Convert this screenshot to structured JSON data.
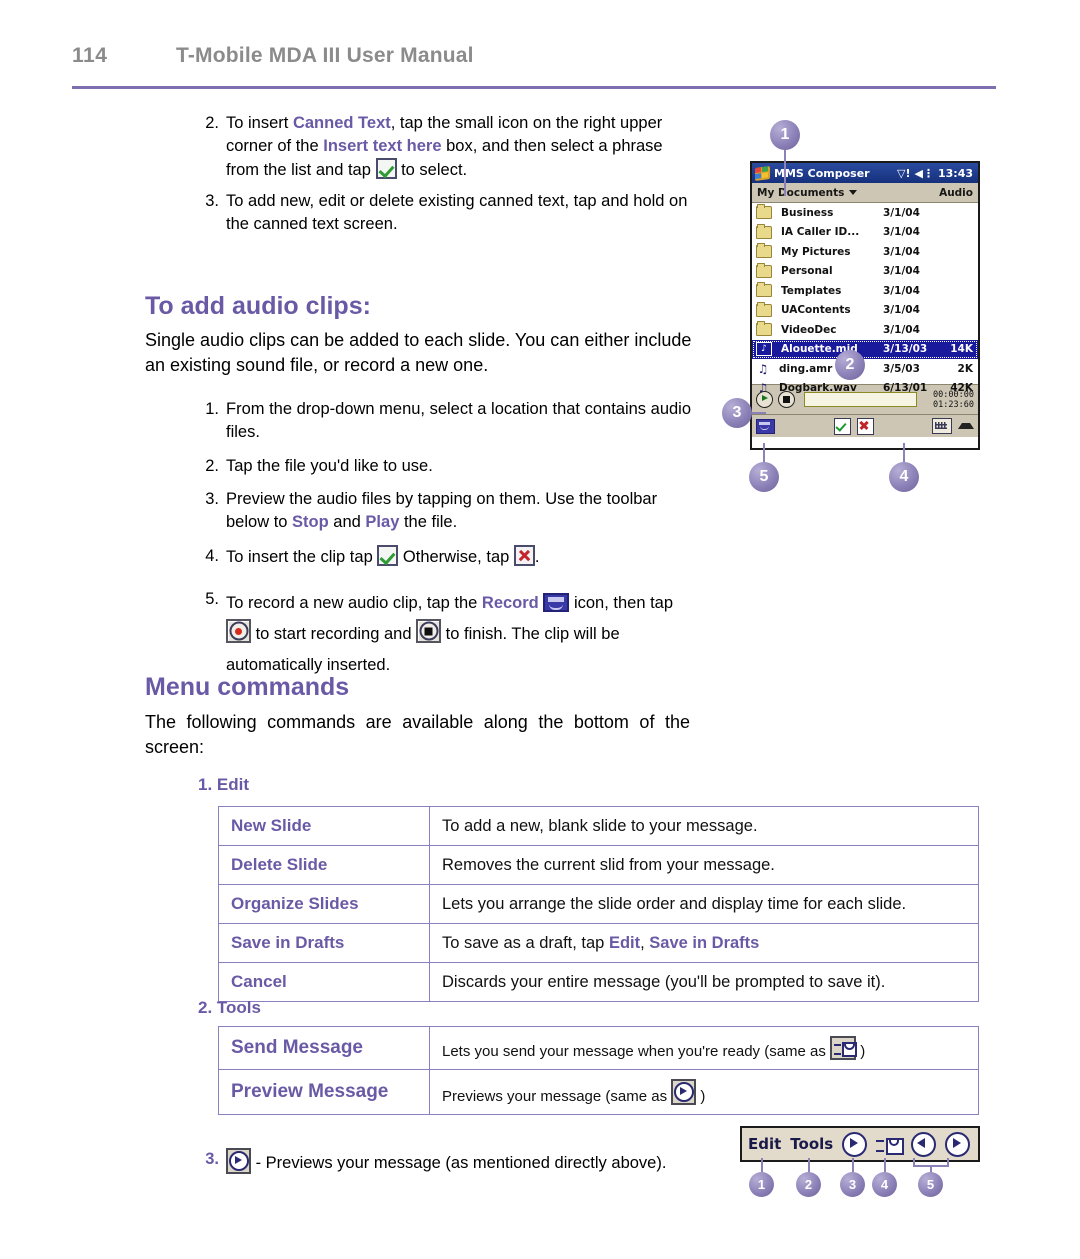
{
  "header": {
    "page_number": "114",
    "book_title": "T-Mobile MDA III User Manual"
  },
  "top_steps": [
    {
      "num": "2.",
      "parts": [
        {
          "t": "To insert ",
          "style": "plain"
        },
        {
          "t": "Canned Text",
          "style": "purple"
        },
        {
          "t": ", tap the small icon on the right upper corner of the ",
          "style": "plain"
        },
        {
          "t": "Insert text here",
          "style": "purple"
        },
        {
          "t": " box, and then select a phrase from the list and tap ",
          "style": "plain"
        },
        {
          "t": "[check-icon]",
          "style": "icon-check"
        },
        {
          "t": " to select.",
          "style": "plain"
        }
      ]
    },
    {
      "num": "3.",
      "parts": [
        {
          "t": "To add new, edit or delete existing canned text, tap and hold on the canned text screen.",
          "style": "plain"
        }
      ]
    }
  ],
  "audio_section": {
    "heading": "To add audio clips:",
    "intro": "Single audio clips can be added to each slide. You can either include an existing sound file, or record a new one.",
    "steps": [
      {
        "num": "1.",
        "text": "From the drop-down menu, select a location that contains audio files."
      },
      {
        "num": "2.",
        "text": "Tap the file you'd like to use."
      },
      {
        "num": "3a.",
        "text": "Preview the audio files by tapping on them. Use the toolbar below to "
      },
      {
        "num": "3b_stop",
        "text": "Stop"
      },
      {
        "num": "3c",
        "text": " and "
      },
      {
        "num": "3d_play",
        "text": "Play"
      },
      {
        "num": "3e",
        "text": " the file."
      },
      {
        "num": "4a",
        "text": "To insert the clip tap "
      },
      {
        "num": "4b",
        "text": " Otherwise, tap "
      },
      {
        "num": "4c",
        "text": "."
      },
      {
        "num": "5a",
        "text": "To record a new audio clip, tap the "
      },
      {
        "num": "5b_record",
        "text": "Record"
      },
      {
        "num": "5c",
        "text": " icon, then tap "
      },
      {
        "num": "5d",
        "text": " to start recording and "
      },
      {
        "num": "5e",
        "text": " to finish. The clip will be automatically inserted."
      }
    ],
    "step1_num": "1.",
    "step1_text": "From the drop-down menu, select a location that contains audio files.",
    "step2_num": "2.",
    "step2_text": "Tap the file you'd like to use.",
    "step3_num": "3.",
    "step3_pre": "Preview the audio files by tapping on them. Use the toolbar below to ",
    "step3_stop": "Stop",
    "step3_mid": " and ",
    "step3_play": "Play",
    "step3_post": " the file.",
    "step4_num": "4.",
    "step4_pre": "To insert the clip tap ",
    "step4_mid": " Otherwise, tap ",
    "step4_post": ".",
    "step5_num": "5.",
    "step5_pre": "To record a new audio clip, tap the ",
    "step5_record": "Record",
    "step5_a": " icon, then tap ",
    "step5_b": " to start recording and ",
    "step5_c": " to finish. The clip will be automatically inserted."
  },
  "menu_section": {
    "heading": "Menu commands",
    "intro": "The following commands are available along the bottom of the screen:",
    "edit_heading": "1. Edit",
    "tools_heading": "2. Tools",
    "edit_rows": [
      {
        "key": "New Slide",
        "value": "To add a new, blank slide to your message."
      },
      {
        "key": "Delete Slide",
        "value": "Removes the current slid from your message."
      },
      {
        "key": "Organize Slides",
        "value": "Lets you arrange the slide order and display time for each slide."
      },
      {
        "key": "Save in Drafts",
        "value": "To save as a draft, tap ",
        "value_link1": "Edit",
        "value_sep": ", ",
        "value_link2": "Save in Drafts"
      },
      {
        "key": "Cancel",
        "value": "Discards your entire message (you'll be prompted to save it)."
      }
    ],
    "tools_rows": [
      {
        "key": "Send Message",
        "value_pre": "Lets you send your message when you're ready (same as ",
        "value_post": " )"
      },
      {
        "key": "Preview Message",
        "value_pre": "Previews your message (same as ",
        "value_post": " )"
      }
    ],
    "final_num": "3.",
    "final_text": " - Previews your message (as mentioned directly above)."
  },
  "pda": {
    "title": "MMS Composer",
    "signal_icon": "signal-icon",
    "speaker_icon": "speaker-icon",
    "clock": "13:43",
    "location": "My Documents",
    "right_label": "Audio",
    "rows": [
      {
        "type": "folder",
        "name": "Business",
        "date": "3/1/04",
        "size": ""
      },
      {
        "type": "folder",
        "name": "IA Caller ID...",
        "date": "3/1/04",
        "size": ""
      },
      {
        "type": "folder",
        "name": "My Pictures",
        "date": "3/1/04",
        "size": ""
      },
      {
        "type": "folder",
        "name": "Personal",
        "date": "3/1/04",
        "size": ""
      },
      {
        "type": "folder",
        "name": "Templates",
        "date": "3/1/04",
        "size": ""
      },
      {
        "type": "folder",
        "name": "UAContents",
        "date": "3/1/04",
        "size": ""
      },
      {
        "type": "folder",
        "name": "VideoDec",
        "date": "3/1/04",
        "size": ""
      },
      {
        "type": "audio",
        "name": "Alouette.mid",
        "date": "3/13/03",
        "size": "14K",
        "selected": true
      },
      {
        "type": "audio",
        "name": "ding.amr",
        "date": "3/5/03",
        "size": "2K"
      },
      {
        "type": "audio",
        "name": "Dogbark.wav",
        "date": "6/13/01",
        "size": "42K"
      }
    ],
    "time_elapsed": "00:00:00",
    "time_total": "01:23:60"
  },
  "callouts": {
    "c1": "1",
    "c2": "2",
    "c3": "3",
    "c4": "4",
    "c5": "5"
  },
  "menu_graphic": {
    "edit_label": "Edit",
    "tools_label": "Tools",
    "icons": [
      "preview-play-icon",
      "send-message-icon",
      "previous-slide-icon",
      "next-slide-icon"
    ],
    "numbers": [
      "1",
      "2",
      "3",
      "4",
      "5"
    ]
  },
  "colors": {
    "accent_purple": "#6a5aa6",
    "header_gray": "#8b8b8b",
    "rule_purple": "#7d6fb0",
    "table_border": "#8b7fc0"
  }
}
